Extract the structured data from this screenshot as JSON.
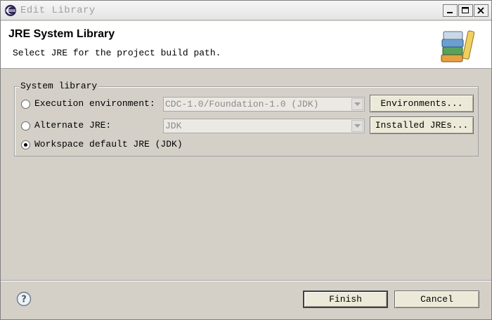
{
  "window": {
    "title": "Edit Library"
  },
  "banner": {
    "title": "JRE System Library",
    "description": "Select JRE for the project build path."
  },
  "group": {
    "legend": "System library",
    "execution_env": {
      "label": "Execution environment:",
      "value": "CDC-1.0/Foundation-1.0 (JDK)",
      "button": "Environments...",
      "selected": false
    },
    "alternate_jre": {
      "label": "Alternate JRE:",
      "value": "JDK",
      "button": "Installed JREs...",
      "selected": false
    },
    "workspace_default": {
      "label": "Workspace default JRE (JDK)",
      "selected": true
    }
  },
  "footer": {
    "finish": "Finish",
    "cancel": "Cancel"
  }
}
